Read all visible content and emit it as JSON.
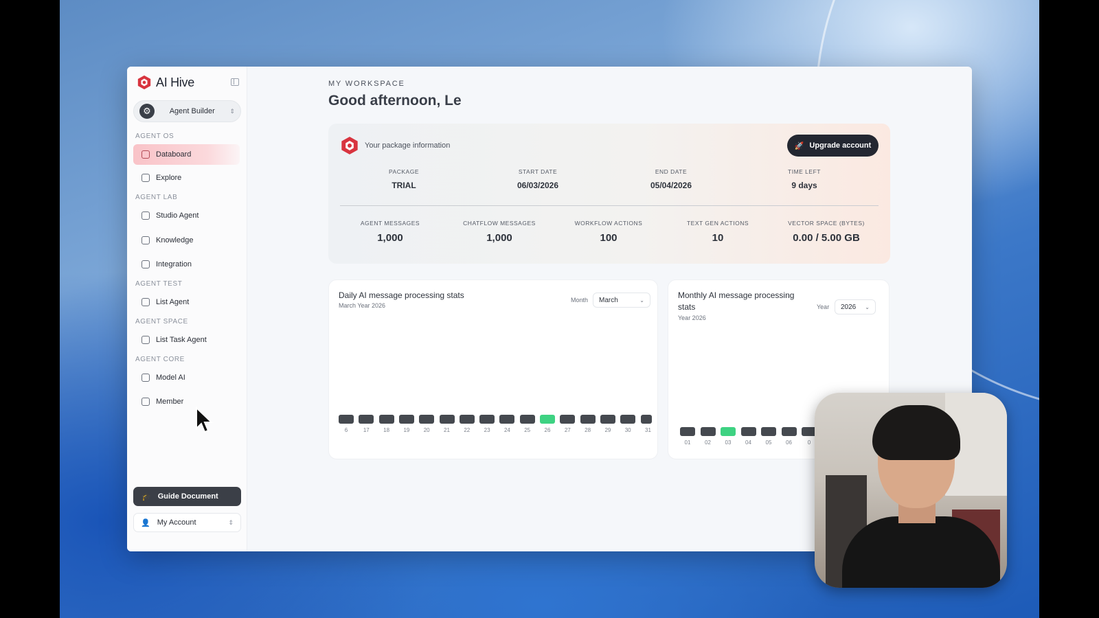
{
  "brand": {
    "name": "AI Hive"
  },
  "switcher": {
    "label": "Agent Builder"
  },
  "sidebar": {
    "sections": {
      "agent_os": "AGENT OS",
      "agent_lab": "AGENT LAB",
      "agent_test": "AGENT TEST",
      "agent_space": "AGENT SPACE",
      "agent_core": "AGENT CORE"
    },
    "items": {
      "databoard": "Databoard",
      "explore": "Explore",
      "studio_agent": "Studio Agent",
      "knowledge": "Knowledge",
      "integration": "Integration",
      "list_agent": "List Agent",
      "list_task_agent": "List Task Agent",
      "model_ai": "Model AI",
      "member": "Member"
    },
    "guide_label": "Guide Document",
    "account_label": "My Account"
  },
  "header": {
    "crumb": "MY WORKSPACE",
    "greeting": "Good afternoon, Le"
  },
  "package": {
    "title": "Your package information",
    "upgrade_label": "Upgrade account",
    "package_key": "PACKAGE",
    "package_val": "TRIAL",
    "start_key": "START DATE",
    "start_val": "06/03/2026",
    "end_key": "END DATE",
    "end_val": "05/04/2026",
    "time_key": "TIME LEFT",
    "time_val": "9 days",
    "agent_msg_key": "AGENT MESSAGES",
    "agent_msg_val": "1,000",
    "chatflow_key": "CHATFLOW MESSAGES",
    "chatflow_val": "1,000",
    "workflow_key": "WORKFLOW ACTIONS",
    "workflow_val": "100",
    "textgen_key": "TEXT GEN ACTIONS",
    "textgen_val": "10",
    "vector_key": "VECTOR SPACE (BYTES)",
    "vector_val": "0.00 / 5.00 GB"
  },
  "daily_chart": {
    "title": "Daily AI message processing stats",
    "subtitle": "March Year 2026",
    "select_label": "Month",
    "select_value": "March",
    "ticks": [
      "6",
      "17",
      "18",
      "19",
      "20",
      "21",
      "22",
      "23",
      "24",
      "25",
      "26",
      "27",
      "28",
      "29",
      "30",
      "31"
    ],
    "highlight": "26"
  },
  "monthly_chart": {
    "title_line1": "Monthly AI message processing",
    "title_line2": "stats",
    "subtitle": "Year 2026",
    "select_label": "Year",
    "select_value": "2026",
    "ticks": [
      "01",
      "02",
      "03",
      "04",
      "05",
      "06",
      "0"
    ],
    "highlight": "03"
  },
  "colors": {
    "accent": "#d8343f",
    "bar": "#45494f",
    "bar_highlight": "#3ed282",
    "dark_button": "#232731"
  }
}
